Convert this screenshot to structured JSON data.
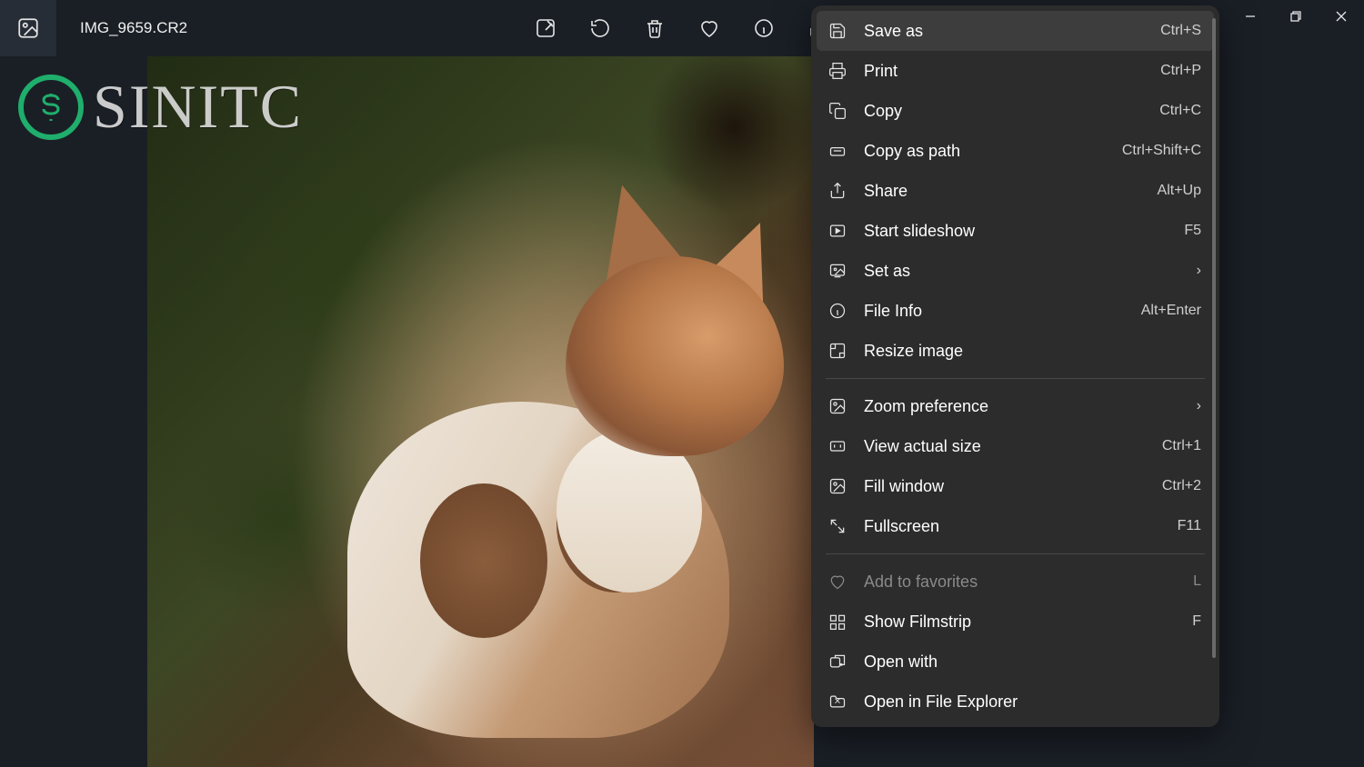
{
  "file_name": "IMG_9659.CR2",
  "watermark_text": "SINITC",
  "menu": {
    "groups": [
      [
        {
          "icon": "save",
          "label": "Save as",
          "shortcut": "Ctrl+S",
          "highlight": true
        },
        {
          "icon": "print",
          "label": "Print",
          "shortcut": "Ctrl+P"
        },
        {
          "icon": "copy",
          "label": "Copy",
          "shortcut": "Ctrl+C"
        },
        {
          "icon": "copy-path",
          "label": "Copy as path",
          "shortcut": "Ctrl+Shift+C"
        },
        {
          "icon": "share",
          "label": "Share",
          "shortcut": "Alt+Up"
        },
        {
          "icon": "slideshow",
          "label": "Start slideshow",
          "shortcut": "F5"
        },
        {
          "icon": "set-as",
          "label": "Set as",
          "submenu": true
        },
        {
          "icon": "info",
          "label": "File Info",
          "shortcut": "Alt+Enter"
        },
        {
          "icon": "resize",
          "label": "Resize image"
        }
      ],
      [
        {
          "icon": "zoom",
          "label": "Zoom preference",
          "submenu": true
        },
        {
          "icon": "actual",
          "label": "View actual size",
          "shortcut": "Ctrl+1"
        },
        {
          "icon": "fill",
          "label": "Fill window",
          "shortcut": "Ctrl+2"
        },
        {
          "icon": "fullscreen",
          "label": "Fullscreen",
          "shortcut": "F11"
        }
      ],
      [
        {
          "icon": "heart",
          "label": "Add to favorites",
          "shortcut": "L",
          "disabled": true
        },
        {
          "icon": "filmstrip",
          "label": "Show Filmstrip",
          "shortcut": "F"
        },
        {
          "icon": "open-with",
          "label": "Open with"
        },
        {
          "icon": "folder",
          "label": "Open in File Explorer"
        }
      ]
    ]
  }
}
